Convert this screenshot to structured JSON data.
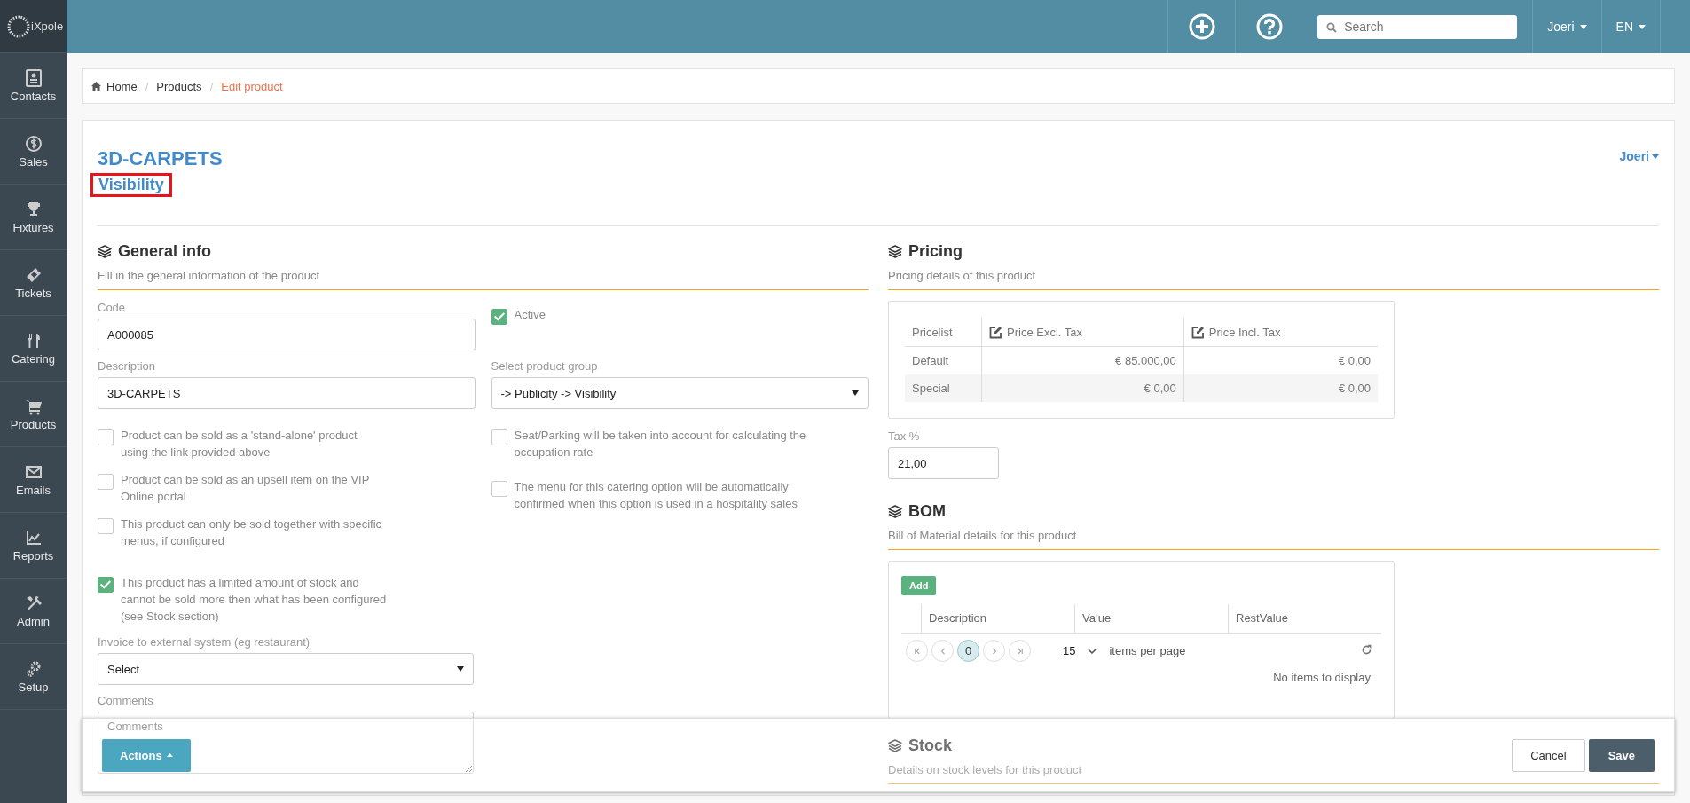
{
  "sidebar": {
    "logo": "iXpole",
    "items": [
      {
        "label": "Contacts"
      },
      {
        "label": "Sales"
      },
      {
        "label": "Fixtures"
      },
      {
        "label": "Tickets"
      },
      {
        "label": "Catering"
      },
      {
        "label": "Products"
      },
      {
        "label": "Emails"
      },
      {
        "label": "Reports"
      },
      {
        "label": "Admin"
      },
      {
        "label": "Setup"
      }
    ]
  },
  "topbar": {
    "search": {
      "placeholder": "Search"
    },
    "user": "Joeri",
    "language": "EN"
  },
  "breadcrumb": {
    "separator": "/",
    "items": [
      {
        "label": "Home",
        "current": false
      },
      {
        "label": "Products",
        "current": false
      },
      {
        "label": "Edit product",
        "current": true
      }
    ]
  },
  "header": {
    "title": "3D-CARPETS",
    "subtitle": "Visibility",
    "highlighted": true,
    "owner": "Joeri"
  },
  "general_info": {
    "heading": "General info",
    "subtitle": "Fill in the general information of the product",
    "code": {
      "label": "Code",
      "value": "A000085"
    },
    "description": {
      "label": "Description",
      "value": "3D-CARPETS"
    },
    "active": {
      "label": "Active",
      "checked": true
    },
    "product_group": {
      "label": "Select product group",
      "value": "-> Publicity -> Visibility"
    },
    "options_left": [
      {
        "label": "Product can be sold as a 'stand-alone' product using the link provided above",
        "checked": false
      },
      {
        "label": "Product can be sold as an upsell item on the VIP Online portal",
        "checked": false
      },
      {
        "label": "This product can only be sold together with specific menus, if configured",
        "checked": false
      },
      {
        "label": "This product has a limited amount of stock and cannot be sold more then what has been configured (see Stock section)",
        "checked": true
      }
    ],
    "options_right": [
      {
        "label": "Seat/Parking will be taken into account for calculating the occupation rate",
        "checked": false
      },
      {
        "label": "The menu for this catering option will be automatically confirmed when this option is used in a hospitality sales",
        "checked": false
      }
    ],
    "invoice": {
      "label": "Invoice to external system (eg restaurant)",
      "value": "Select"
    },
    "comments": {
      "label": "Comments",
      "placeholder": "Comments"
    }
  },
  "pricing": {
    "heading": "Pricing",
    "subtitle": "Pricing details of this product",
    "columns": [
      {
        "label": "Pricelist",
        "editable": false
      },
      {
        "label": "Price Excl. Tax",
        "editable": true
      },
      {
        "label": "Price Incl. Tax",
        "editable": true
      }
    ],
    "rows": [
      [
        "Default",
        "€ 85.000,00",
        "€ 0,00"
      ],
      [
        "Special",
        "€ 0,00",
        "€ 0,00"
      ]
    ],
    "tax": {
      "label": "Tax %",
      "value": "21,00"
    }
  },
  "bom": {
    "heading": "BOM",
    "subtitle": "Bill of Material details for this product",
    "add": "Add",
    "columns": [
      "Description",
      "Value",
      "RestValue"
    ],
    "page": "0",
    "page_size": "15",
    "per_page": "items per page",
    "empty": "No items to display"
  },
  "stock": {
    "heading": "Stock",
    "subtitle": "Details on stock levels for this product"
  },
  "actions": {
    "menu": "Actions",
    "cancel": "Cancel",
    "save": "Save"
  }
}
